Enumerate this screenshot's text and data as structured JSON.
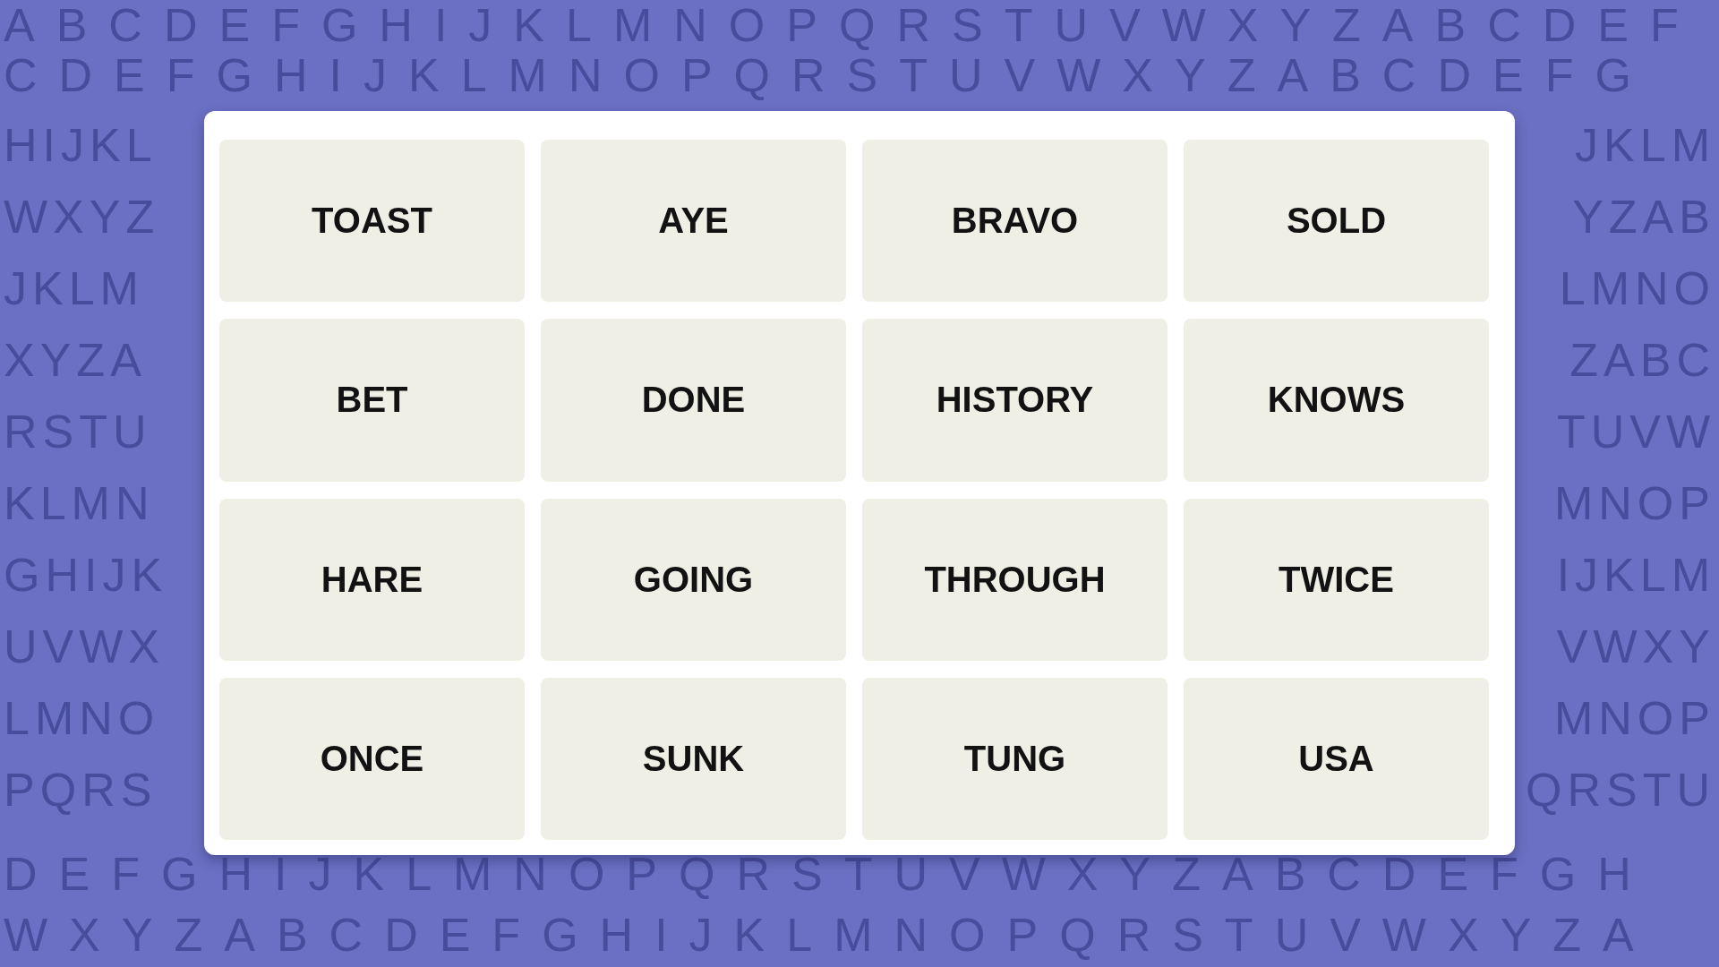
{
  "background_rows": [
    {
      "kind": "full",
      "text": "ABCDEFGHIJKLMNOPQRSTUVWXYZABCDEF"
    },
    {
      "kind": "full",
      "text": "CDEFGHIJKLMNOPQRSTUVWXYZABCDEFG"
    },
    {
      "kind": "split",
      "left": "HIJKL",
      "right": "JKLM"
    },
    {
      "kind": "split",
      "left": "WXYZ",
      "right": "YZAB"
    },
    {
      "kind": "split",
      "left": "JKLM",
      "right": "LMNO"
    },
    {
      "kind": "split",
      "left": "XYZA",
      "right": "ZABC"
    },
    {
      "kind": "split",
      "left": "RSTU",
      "right": "TUVW"
    },
    {
      "kind": "split",
      "left": "KLMN",
      "right": "MNOP"
    },
    {
      "kind": "split",
      "left": "GHIJK",
      "right": "IJKLM"
    },
    {
      "kind": "split",
      "left": "UVWX",
      "right": "VWXY"
    },
    {
      "kind": "split",
      "left": "LMNO",
      "right": "MNOP"
    },
    {
      "kind": "split",
      "left": "PQRS",
      "right": "QRSTU"
    },
    {
      "kind": "full",
      "text": "DEFGHIJKLMNOPQRSTUVWXYZABCDEFGH"
    },
    {
      "kind": "full",
      "text": "WXYZABCDEFGHIJKLMNOPQRSTUVWXYZA"
    }
  ],
  "tiles": [
    {
      "label": "TOAST"
    },
    {
      "label": "AYE"
    },
    {
      "label": "BRAVO"
    },
    {
      "label": "SOLD"
    },
    {
      "label": "BET"
    },
    {
      "label": "DONE"
    },
    {
      "label": "HISTORY"
    },
    {
      "label": "KNOWS"
    },
    {
      "label": "HARE"
    },
    {
      "label": "GOING"
    },
    {
      "label": "THROUGH"
    },
    {
      "label": "TWICE"
    },
    {
      "label": "ONCE"
    },
    {
      "label": "SUNK"
    },
    {
      "label": "TUNG"
    },
    {
      "label": "USA"
    }
  ]
}
